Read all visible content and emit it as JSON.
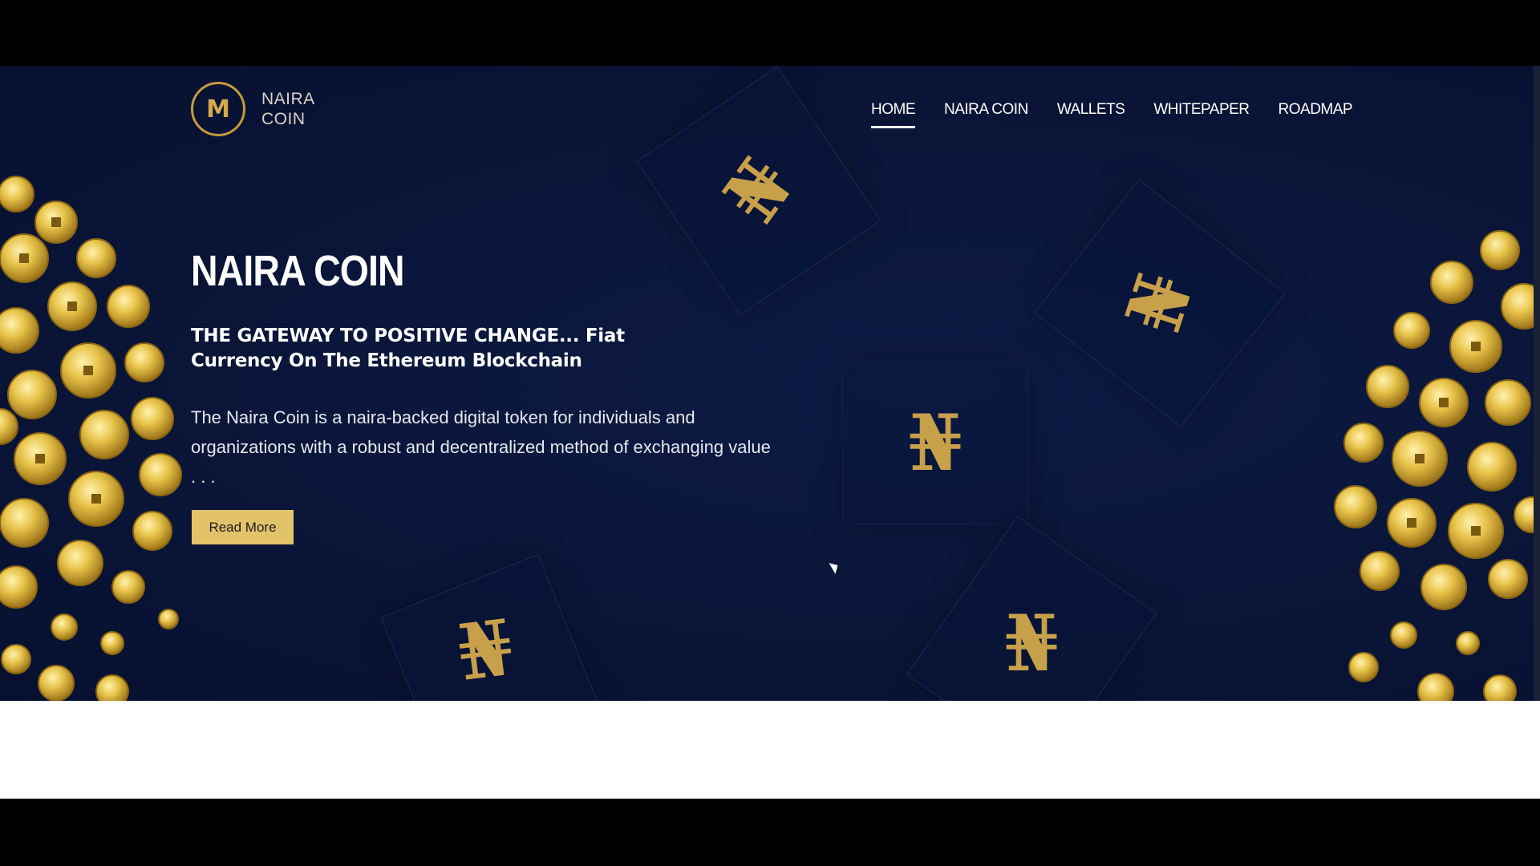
{
  "header": {
    "logo_line1": "NAIRA",
    "logo_line2": "COIN",
    "logo_glyph": "M",
    "nav": [
      {
        "label": "HOME",
        "active": true
      },
      {
        "label": "NAIRA COIN",
        "active": false
      },
      {
        "label": "WALLETS",
        "active": false
      },
      {
        "label": "WHITEPAPER",
        "active": false
      },
      {
        "label": "ROADMAP",
        "active": false
      }
    ]
  },
  "hero": {
    "title": "NAIRA COIN",
    "subtitle": "THE GATEWAY TO POSITIVE CHANGE... Fiat Currency On The Ethereum Blockchain",
    "body": "The Naira Coin is a naira-backed digital token for individuals and organizations with a robust and decentralized method of exchanging value . . .",
    "cta_label": "Read More"
  },
  "decor": {
    "tile_symbol": "₦",
    "icon_names": [
      "naira-coin-logo-icon",
      "naira-tile-icon",
      "gold-coins-cluster",
      "mouse-cursor-icon"
    ]
  },
  "colors": {
    "hero_bg": "#0a1538",
    "accent_gold": "#e2c36a",
    "logo_gold": "#c59a3c",
    "frame_bg": "#000000"
  }
}
